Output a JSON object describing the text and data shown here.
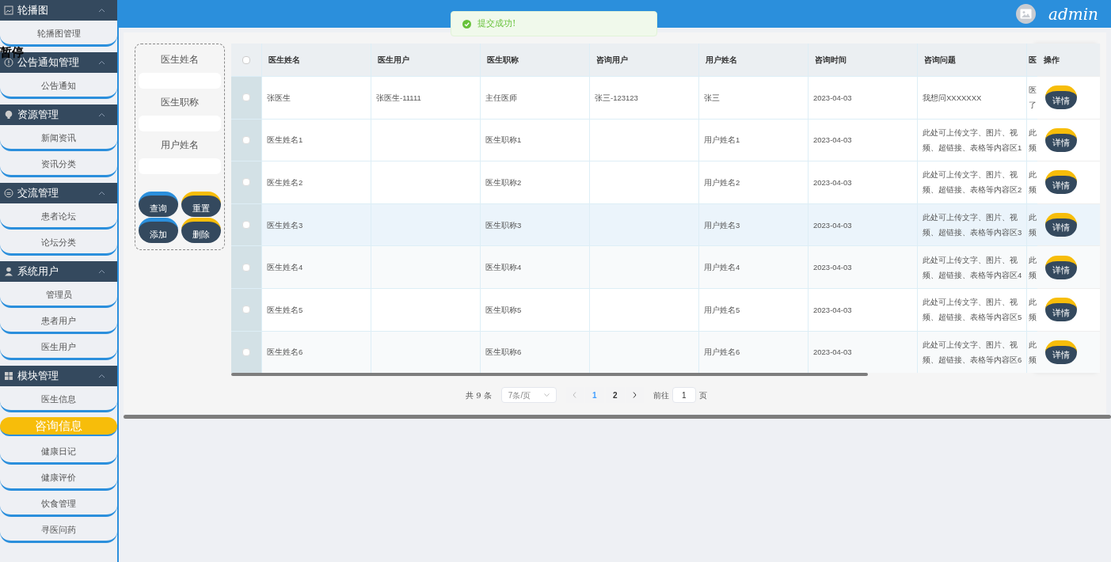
{
  "sidebar": {
    "groups": [
      {
        "title": "轮播图",
        "expanded": true,
        "items": [
          {
            "label": "轮播图管理",
            "selected": false
          }
        ]
      },
      {
        "title": "公告通知管理",
        "expanded": true,
        "items": [
          {
            "label": "公告通知",
            "selected": false
          }
        ]
      },
      {
        "title": "资源管理",
        "expanded": true,
        "items": [
          {
            "label": "新闻资讯",
            "selected": false
          },
          {
            "label": "资讯分类",
            "selected": false
          }
        ]
      },
      {
        "title": "交流管理",
        "expanded": true,
        "items": [
          {
            "label": "患者论坛",
            "selected": false
          },
          {
            "label": "论坛分类",
            "selected": false
          }
        ]
      },
      {
        "title": "系统用户",
        "expanded": true,
        "items": [
          {
            "label": "管理员",
            "selected": false
          },
          {
            "label": "患者用户",
            "selected": false
          },
          {
            "label": "医生用户",
            "selected": false
          }
        ]
      },
      {
        "title": "模块管理",
        "expanded": true,
        "items": [
          {
            "label": "医生信息",
            "selected": false
          },
          {
            "label": "咨询信息",
            "selected": true
          },
          {
            "label": "健康日记",
            "selected": false
          },
          {
            "label": "健康评价",
            "selected": false
          },
          {
            "label": "饮食管理",
            "selected": false
          },
          {
            "label": "寻医问药",
            "selected": false
          }
        ]
      }
    ]
  },
  "overlay_caption": "暂停",
  "header": {
    "user": "admin"
  },
  "toast": {
    "message": "提交成功!"
  },
  "search": {
    "fields": [
      {
        "label": "医生姓名"
      },
      {
        "label": "医生职称"
      },
      {
        "label": "用户姓名"
      }
    ],
    "buttons": [
      {
        "label": "查询"
      },
      {
        "label": "重置"
      },
      {
        "label": "添加"
      },
      {
        "label": "删除"
      }
    ]
  },
  "table": {
    "select_all_checked": false,
    "columns": [
      "医生姓名",
      "医生用户",
      "医生职称",
      "咨询用户",
      "用户姓名",
      "咨询时间",
      "咨询问题",
      "医"
    ],
    "action_column": "操作",
    "rows": [
      {
        "checked": false,
        "highlighted": false,
        "cells": [
          "张医生",
          "张医生-11111",
          "主任医师",
          "张三-123123",
          "张三",
          "2023-04-03",
          "我想问XXXXXXX"
        ],
        "column_8_lines": [
          "医",
          "了"
        ],
        "action": "详情"
      },
      {
        "checked": false,
        "highlighted": false,
        "cells": [
          "医生姓名1",
          "",
          "医生职称1",
          "",
          "用户姓名1",
          "2023-04-03",
          "此处可上传文字、图片、视频、超链接、表格等内容区1"
        ],
        "column_8_lines": [
          "此",
          "频"
        ],
        "action": "详情"
      },
      {
        "checked": false,
        "highlighted": false,
        "cells": [
          "医生姓名2",
          "",
          "医生职称2",
          "",
          "用户姓名2",
          "2023-04-03",
          "此处可上传文字、图片、视频、超链接、表格等内容区2"
        ],
        "column_8_lines": [
          "此",
          "频"
        ],
        "action": "详情"
      },
      {
        "checked": false,
        "highlighted": true,
        "cells": [
          "医生姓名3",
          "",
          "医生职称3",
          "",
          "用户姓名3",
          "2023-04-03",
          "此处可上传文字、图片、视频、超链接、表格等内容区3"
        ],
        "column_8_lines": [
          "此",
          "频"
        ],
        "action": "详情"
      },
      {
        "checked": false,
        "highlighted": false,
        "cells": [
          "医生姓名4",
          "",
          "医生职称4",
          "",
          "用户姓名4",
          "2023-04-03",
          "此处可上传文字、图片、视频、超链接、表格等内容区4"
        ],
        "column_8_lines": [
          "此",
          "频"
        ],
        "action": "详情"
      },
      {
        "checked": false,
        "highlighted": false,
        "cells": [
          "医生姓名5",
          "",
          "医生职称5",
          "",
          "用户姓名5",
          "2023-04-03",
          "此处可上传文字、图片、视频、超链接、表格等内容区5"
        ],
        "column_8_lines": [
          "此",
          "频"
        ],
        "action": "详情"
      },
      {
        "checked": false,
        "highlighted": false,
        "cells": [
          "医生姓名6",
          "",
          "医生职称6",
          "",
          "用户姓名6",
          "2023-04-03",
          "此处可上传文字、图片、视频、超链接、表格等内容区6"
        ],
        "column_8_lines": [
          "此",
          "频"
        ],
        "action": "详情"
      }
    ]
  },
  "pagination": {
    "total": "共 9 条",
    "page_size": "7条/页",
    "pages": [
      {
        "label": "1",
        "selected": true
      },
      {
        "label": "2",
        "selected": false
      }
    ],
    "goto_label": "前往",
    "goto_value": "1",
    "goto_suffix": "页"
  }
}
